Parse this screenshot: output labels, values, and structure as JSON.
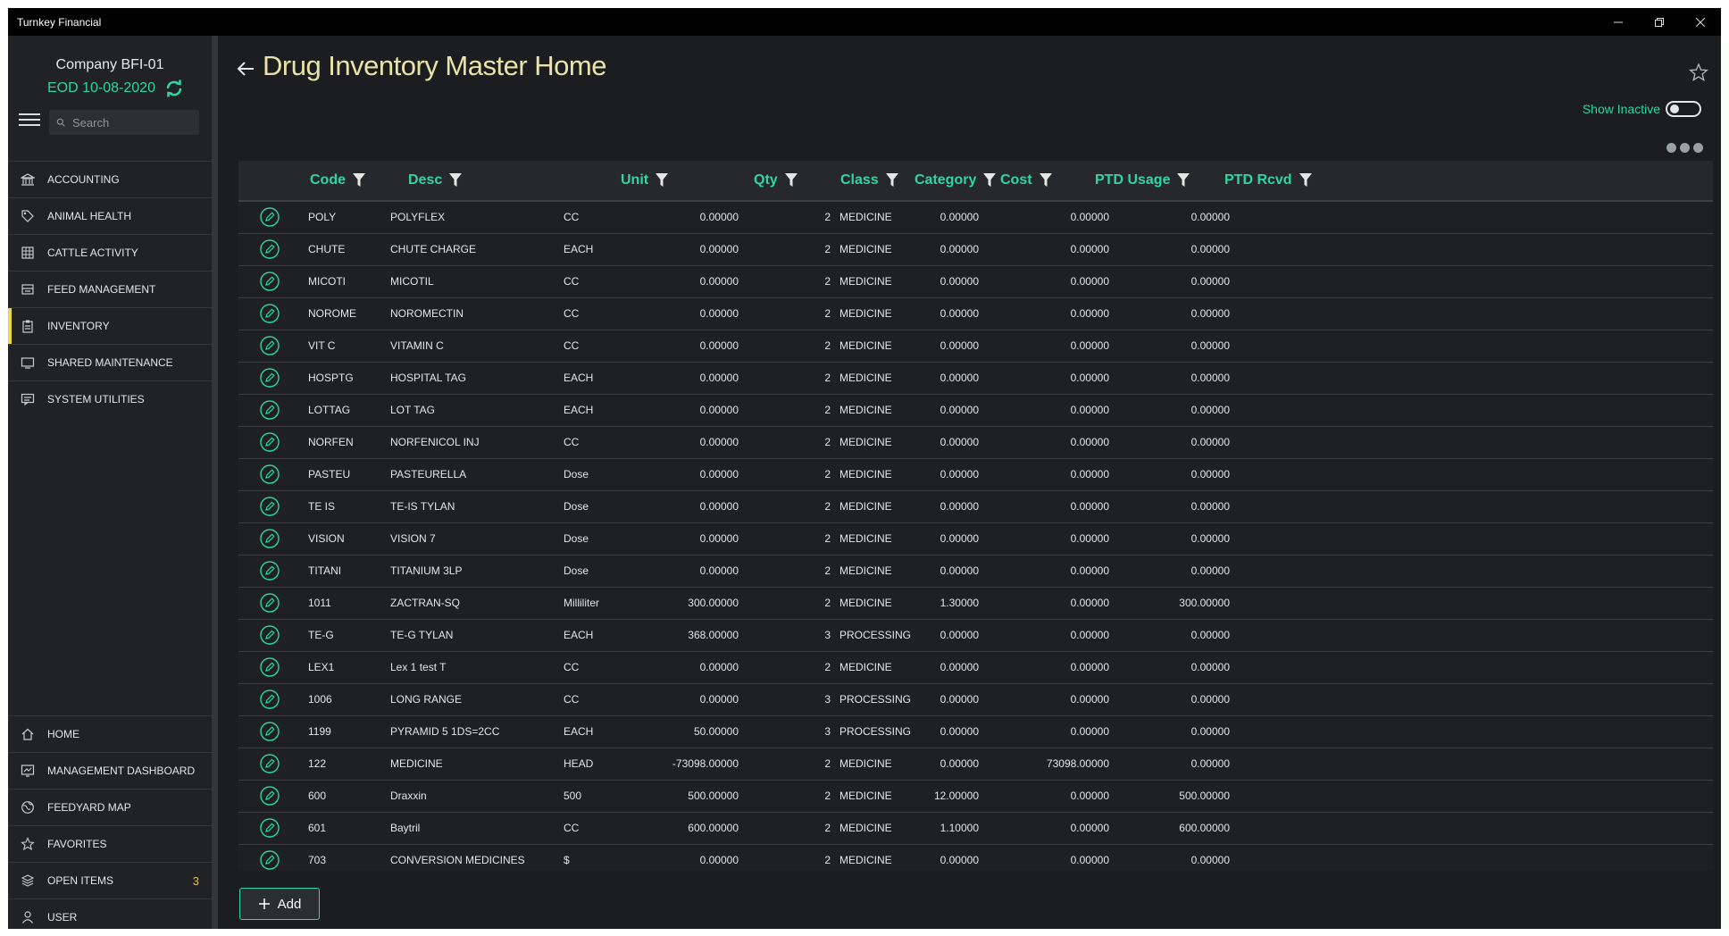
{
  "window": {
    "title": "Turnkey Financial",
    "controls": [
      "minimize",
      "restore",
      "close"
    ]
  },
  "sidebar": {
    "company": "Company BFI-01",
    "eod": "EOD 10-08-2020",
    "search_placeholder": "Search",
    "nav_top": [
      {
        "label": "ACCOUNTING",
        "icon": "bank-icon"
      },
      {
        "label": "ANIMAL HEALTH",
        "icon": "tag-icon"
      },
      {
        "label": "CATTLE ACTIVITY",
        "icon": "grid-icon"
      },
      {
        "label": "FEED MANAGEMENT",
        "icon": "feed-icon"
      },
      {
        "label": "INVENTORY",
        "icon": "clipboard-icon",
        "active": true
      },
      {
        "label": "SHARED MAINTENANCE",
        "icon": "monitor-icon"
      },
      {
        "label": "SYSTEM UTILITIES",
        "icon": "chat-icon"
      }
    ],
    "nav_bottom": [
      {
        "label": "HOME",
        "icon": "home-icon"
      },
      {
        "label": "MANAGEMENT DASHBOARD",
        "icon": "dashboard-icon"
      },
      {
        "label": "FEEDYARD MAP",
        "icon": "globe-icon"
      },
      {
        "label": "FAVORITES",
        "icon": "star-icon"
      },
      {
        "label": "OPEN ITEMS",
        "icon": "layers-icon",
        "badge": "3"
      },
      {
        "label": "USER",
        "icon": "user-icon"
      }
    ]
  },
  "main": {
    "title": "Drug Inventory Master Home",
    "show_inactive_label": "Show Inactive",
    "add_label": "Add"
  },
  "table": {
    "columns": [
      "Code",
      "Desc",
      "Unit",
      "Qty",
      "Class",
      "Category",
      "Cost",
      "PTD Usage",
      "PTD Rcvd"
    ],
    "rows": [
      [
        "POLY",
        "POLYFLEX",
        "CC",
        "0.00000",
        "2",
        "MEDICINE",
        "0.00000",
        "0.00000",
        "0.00000"
      ],
      [
        "CHUTE",
        "CHUTE CHARGE",
        "EACH",
        "0.00000",
        "2",
        "MEDICINE",
        "0.00000",
        "0.00000",
        "0.00000"
      ],
      [
        "MICOTI",
        "MICOTIL",
        "CC",
        "0.00000",
        "2",
        "MEDICINE",
        "0.00000",
        "0.00000",
        "0.00000"
      ],
      [
        "NOROME",
        "NOROMECTIN",
        "CC",
        "0.00000",
        "2",
        "MEDICINE",
        "0.00000",
        "0.00000",
        "0.00000"
      ],
      [
        "VIT C",
        "VITAMIN C",
        "CC",
        "0.00000",
        "2",
        "MEDICINE",
        "0.00000",
        "0.00000",
        "0.00000"
      ],
      [
        "HOSPTG",
        "HOSPITAL TAG",
        "EACH",
        "0.00000",
        "2",
        "MEDICINE",
        "0.00000",
        "0.00000",
        "0.00000"
      ],
      [
        "LOTTAG",
        "LOT TAG",
        "EACH",
        "0.00000",
        "2",
        "MEDICINE",
        "0.00000",
        "0.00000",
        "0.00000"
      ],
      [
        "NORFEN",
        "NORFENICOL INJ",
        "CC",
        "0.00000",
        "2",
        "MEDICINE",
        "0.00000",
        "0.00000",
        "0.00000"
      ],
      [
        "PASTEU",
        "PASTEURELLA",
        "Dose",
        "0.00000",
        "2",
        "MEDICINE",
        "0.00000",
        "0.00000",
        "0.00000"
      ],
      [
        "TE IS",
        "TE-IS TYLAN",
        "Dose",
        "0.00000",
        "2",
        "MEDICINE",
        "0.00000",
        "0.00000",
        "0.00000"
      ],
      [
        "VISION",
        "VISION 7",
        "Dose",
        "0.00000",
        "2",
        "MEDICINE",
        "0.00000",
        "0.00000",
        "0.00000"
      ],
      [
        "TITANI",
        "TITANIUM 3LP",
        "Dose",
        "0.00000",
        "2",
        "MEDICINE",
        "0.00000",
        "0.00000",
        "0.00000"
      ],
      [
        "1011",
        "ZACTRAN-SQ",
        "Milliliter",
        "300.00000",
        "2",
        "MEDICINE",
        "1.30000",
        "0.00000",
        "300.00000"
      ],
      [
        "TE-G",
        "TE-G TYLAN",
        "EACH",
        "368.00000",
        "3",
        "PROCESSING",
        "0.00000",
        "0.00000",
        "0.00000"
      ],
      [
        "LEX1",
        "Lex 1 test T",
        "CC",
        "0.00000",
        "2",
        "MEDICINE",
        "0.00000",
        "0.00000",
        "0.00000"
      ],
      [
        "1006",
        "LONG RANGE",
        "CC",
        "0.00000",
        "3",
        "PROCESSING",
        "0.00000",
        "0.00000",
        "0.00000"
      ],
      [
        "1199",
        "PYRAMID 5 1DS=2CC",
        "EACH",
        "50.00000",
        "3",
        "PROCESSING",
        "0.00000",
        "0.00000",
        "0.00000"
      ],
      [
        "122",
        "MEDICINE",
        "HEAD",
        "-73098.00000",
        "2",
        "MEDICINE",
        "0.00000",
        "73098.00000",
        "0.00000"
      ],
      [
        "600",
        "Draxxin",
        "500",
        "500.00000",
        "2",
        "MEDICINE",
        "12.00000",
        "0.00000",
        "500.00000"
      ],
      [
        "601",
        "Baytril",
        "CC",
        "600.00000",
        "2",
        "MEDICINE",
        "1.10000",
        "0.00000",
        "600.00000"
      ],
      [
        "703",
        "CONVERSION MEDICINES",
        "$",
        "0.00000",
        "2",
        "MEDICINE",
        "0.00000",
        "0.00000",
        "0.00000"
      ]
    ]
  },
  "colors": {
    "accent": "#2fd6a3",
    "title": "#e8e3a8",
    "active_marker": "#e9d94a",
    "badge": "#e9c23f"
  }
}
